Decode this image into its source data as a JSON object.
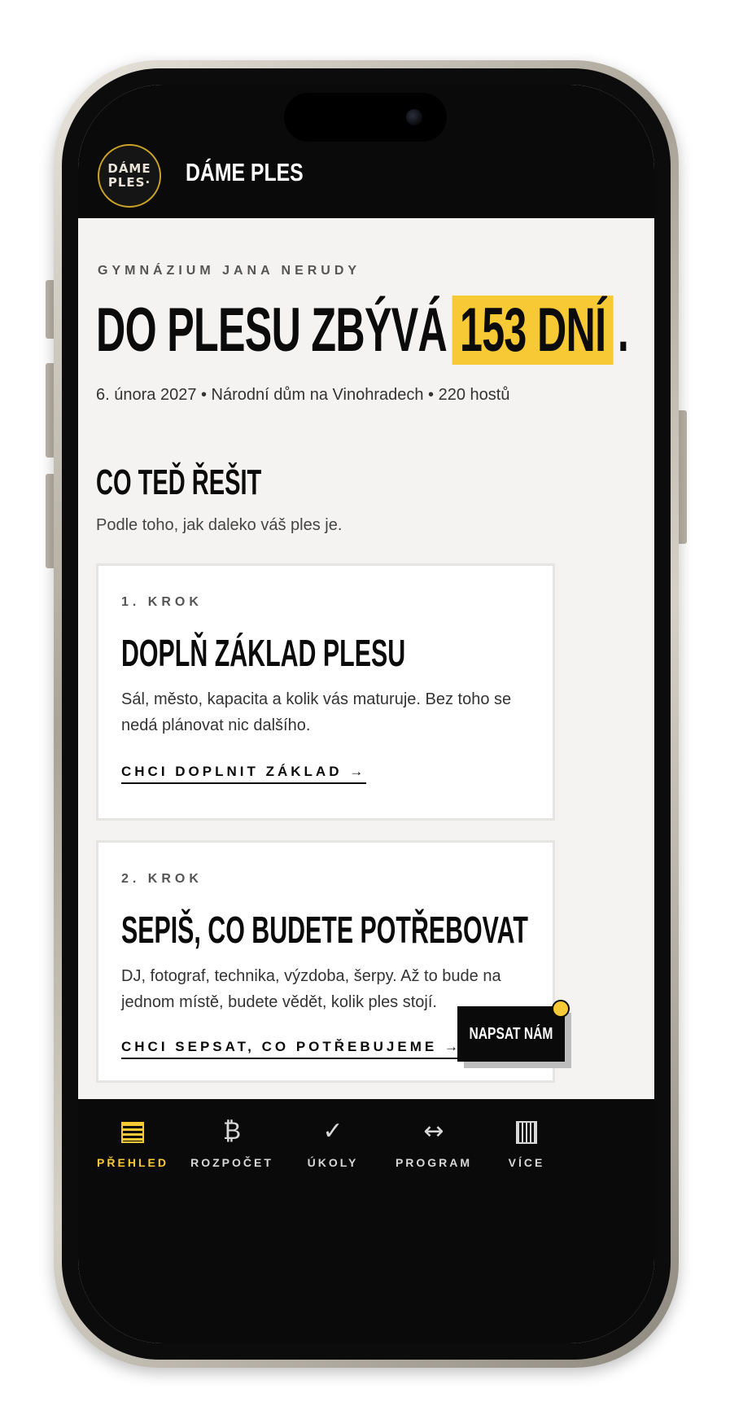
{
  "header": {
    "logo_line1": "DÁME",
    "logo_line2": "PLES·",
    "app_title": "DÁME PLES"
  },
  "hero": {
    "school": "GYMNÁZIUM JANA NERUDY",
    "headline_prefix": "DO PLESU ZBÝVÁ",
    "countdown": "153 DNÍ",
    "headline_suffix": ".",
    "details": "6. února 2027 • Národní dům na Vinohradech • 220 hostů"
  },
  "section": {
    "title": "CO TEĎ ŘEŠIT",
    "subtitle": "Podle toho, jak daleko váš ples je."
  },
  "cards": [
    {
      "step": "1. KROK",
      "title": "DOPLŇ ZÁKLAD PLESU",
      "text": "Sál, město, kapacita a kolik vás maturuje. Bez toho se nedá plánovat nic dalšího.",
      "link": "CHCI DOPLNIT ZÁKLAD →"
    },
    {
      "step": "2. KROK",
      "title": "SEPIŠ, CO BUDETE POTŘEBOVAT",
      "text": "DJ, fotograf, technika, výzdoba, šerpy. Až to bude na jednom místě, budete vědět, kolik ples stojí.",
      "link": "CHCI SEPSAT, CO POTŘEBUJEME →"
    }
  ],
  "fab": {
    "label": "NAPSAT NÁM"
  },
  "tabs": [
    {
      "icon": "overview-icon",
      "label": "PŘEHLED",
      "active": true
    },
    {
      "icon": "bitcoin-icon",
      "glyph": "₿",
      "label": "ROZPOČET",
      "active": false
    },
    {
      "icon": "checkmark-icon",
      "glyph": "✓",
      "label": "ÚKOLY",
      "active": false
    },
    {
      "icon": "arrows-horizontal-icon",
      "glyph": "↔",
      "label": "PROGRAM",
      "active": false
    },
    {
      "icon": "more-icon",
      "label": "VÍCE",
      "active": false
    }
  ],
  "colors": {
    "accent": "#f6c935",
    "header_bg": "#0a0a0a",
    "page_bg": "#f4f3f1"
  }
}
